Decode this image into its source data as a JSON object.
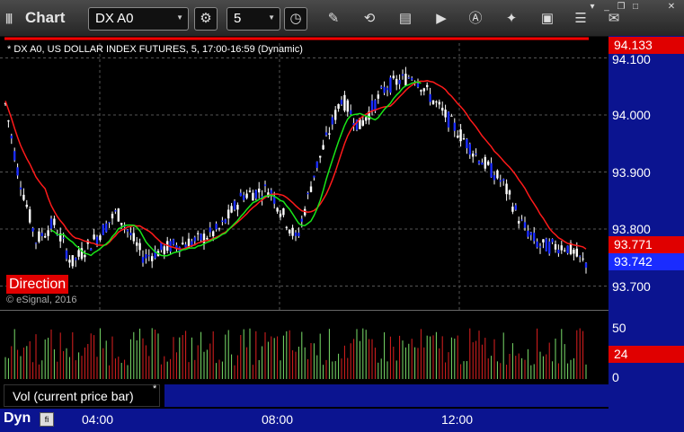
{
  "toolbar": {
    "title": "Chart",
    "symbol": "DX A0",
    "interval": "5"
  },
  "chart": {
    "header": "* DX A0, US DOLLAR INDEX FUTURES, 5, 17:00-16:59 (Dynamic)",
    "copyright": "© eSignal, 2016",
    "study_label": "Direction",
    "price_axis": [
      "94.100",
      "94.000",
      "93.900",
      "93.800",
      "93.700"
    ],
    "badge_high": "94.133",
    "badge_mid": "93.771",
    "badge_last": "93.742",
    "colors": {
      "up_bar": "#ffffff",
      "down_bar": "#1a2cff",
      "ma_red": "#ff1a1a",
      "ma_green": "#19e619",
      "panel_blue": "#0b1490",
      "badge_red": "#e00000"
    }
  },
  "volume": {
    "label": "Vol (current price bar)",
    "close_symbol": "*",
    "axis": [
      "50",
      "0"
    ],
    "badge": "24"
  },
  "footer": {
    "mode": "Dyn",
    "times": [
      "04:00",
      "08:00",
      "12:00"
    ]
  }
}
